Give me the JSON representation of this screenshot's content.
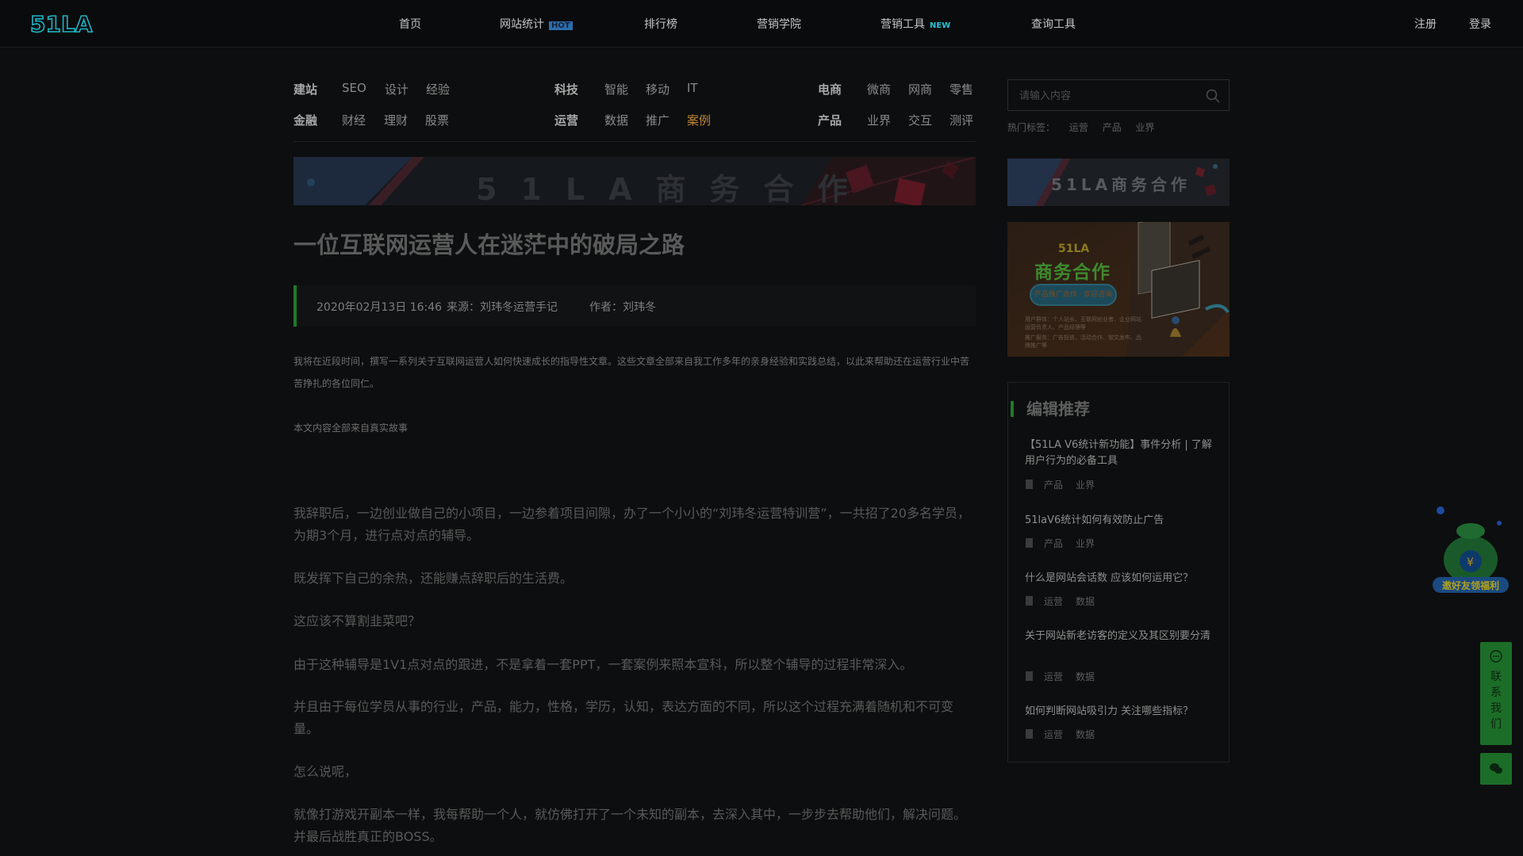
{
  "header": {
    "logo_text": "51LA",
    "nav": [
      {
        "label": "首页",
        "badge": ""
      },
      {
        "label": "网站统计",
        "badge": "HOT"
      },
      {
        "label": "排行榜",
        "badge": ""
      },
      {
        "label": "营销学院",
        "badge": ""
      },
      {
        "label": "营销工具",
        "badge": "NEW"
      },
      {
        "label": "查询工具",
        "badge": ""
      }
    ],
    "register": "注册",
    "login": "登录"
  },
  "categories": {
    "group1": {
      "row1": [
        "建站",
        "SEO",
        "设计",
        "经验"
      ],
      "row2": [
        "金融",
        "财经",
        "理财",
        "股票"
      ]
    },
    "group2": {
      "row1": [
        "科技",
        "智能",
        "移动",
        "IT"
      ],
      "row2": [
        "运营",
        "数据",
        "推广",
        "案例"
      ]
    },
    "group3": {
      "row1": [
        "电商",
        "微商",
        "网商",
        "零售"
      ],
      "row2": [
        "产品",
        "业界",
        "交互",
        "测评"
      ]
    },
    "active": "案例"
  },
  "banner_text": "51LA商务合作",
  "article": {
    "title": "一位互联网运营人在迷茫中的破局之路",
    "date": "2020年02月13日 16:46",
    "source": "来源：刘玮冬运营手记",
    "author": "作者：刘玮冬",
    "intro": "我将在近段时间，撰写一系列关于互联网运营人如何快速成长的指导性文章。这些文章全部来自我工作多年的亲身经验和实践总结，以此来帮助还在运营行业中苦苦挣扎的各位同仁。",
    "note": "本文内容全部来自真实故事",
    "paragraphs": [
      "我辞职后，一边创业做自己的小项目，一边参着项目间隙，办了一个小小的“刘玮冬运营特训营”，一共招了20多名学员，为期3个月，进行点对点的辅导。",
      "既发挥下自己的余热，还能赚点辞职后的生活费。",
      "这应该不算割韭菜吧？",
      "由于这种辅导是1V1点对点的跟进，不是拿着一套PPT，一套案例来照本宣科，所以整个辅导的过程非常深入。",
      "并且由于每位学员从事的行业，产品，能力，性格，学历，认知，表达方面的不同，所以这个过程充满着随机和不可变量。",
      "怎么说呢，",
      "就像打游戏开副本一样，我每帮助一个人，就仿佛打开了一个未知的副本，去深入其中，一步步去帮助他们，解决问题。并最后战胜真正的BOSS。"
    ]
  },
  "sidebar": {
    "search_placeholder": "请输入内容",
    "hot_label": "热门标签：",
    "hot_tags": [
      "运营",
      "产品",
      "业界"
    ],
    "banner_small_text": "51LA商务合作",
    "ad": {
      "brand": "51LA",
      "headline": "商务合作",
      "pill": "产品推广合作  ·  欢迎咨询",
      "line1": "用户群体：个人站长、互联网创业者、企业网站运营负责人、产品经理等",
      "line2": "推广服务：广告投放、活动合作、软文发布、品牌推广等"
    },
    "recommend_title": "编辑推荐",
    "recommend": [
      {
        "title": "【51LA V6统计新功能】事件分析 | 了解用户行为的必备工具",
        "tags": [
          "产品",
          "业界"
        ]
      },
      {
        "title": "51laV6统计如何有效防止广告",
        "tags": [
          "产品",
          "业界"
        ]
      },
      {
        "title": "什么是网站会话数 应该如何运用它？",
        "tags": [
          "运营",
          "数据"
        ]
      },
      {
        "title": "关于网站新老访客的定义及其区别要分清",
        "tags": [
          "运营",
          "数据"
        ]
      },
      {
        "title": "如何判断网站吸引力 关注哪些指标？",
        "tags": [
          "运营",
          "数据"
        ]
      }
    ]
  },
  "floating": {
    "mascot_label": "邀好友领福利",
    "contact": [
      "联",
      "系",
      "我",
      "们"
    ]
  },
  "colors": {
    "accent_green": "#1f7a2a",
    "active_orange": "#c2873a",
    "logo_teal": "#1fb3c4"
  }
}
